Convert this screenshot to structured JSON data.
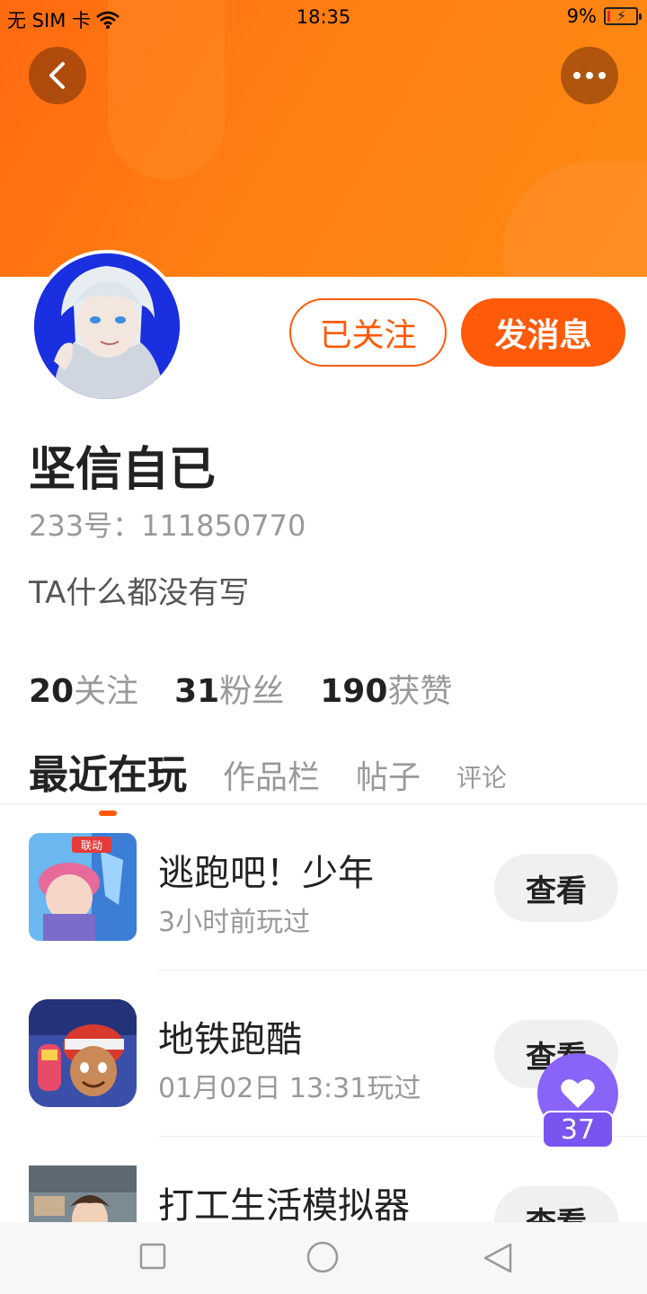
{
  "status_bar": {
    "carrier": "无 SIM 卡",
    "time": "18:35",
    "battery": "9%"
  },
  "header": {
    "back_icon": "chevron-left-icon",
    "more_icon": "more-dots-icon",
    "accent_color": "#ff5a0a"
  },
  "profile": {
    "follow_button": "已关注",
    "message_button": "发消息",
    "username": "坚信自已",
    "uid": "233号：111850770",
    "bio": "TA什么都没有写"
  },
  "stats": [
    {
      "num": "20",
      "label": "关注"
    },
    {
      "num": "31",
      "label": "粉丝"
    },
    {
      "num": "190",
      "label": "获赞"
    }
  ],
  "tabs": [
    "最近在玩",
    "作品栏",
    "帖子",
    "评论"
  ],
  "games": [
    {
      "title": "逃跑吧！少年",
      "time": "3小时前玩过",
      "button": "查看",
      "badge": "联动"
    },
    {
      "title": "地铁跑酷",
      "time": "01月02日 13:31玩过",
      "button": "查看"
    },
    {
      "title": "打工生活模拟器",
      "time": "",
      "button": "查看"
    }
  ],
  "like_fab": {
    "count": "37",
    "icon": "heart-icon",
    "color": "#8a64f8"
  },
  "nav_bar": {
    "icons": [
      "square-icon",
      "circle-icon",
      "triangle-back-icon"
    ]
  }
}
